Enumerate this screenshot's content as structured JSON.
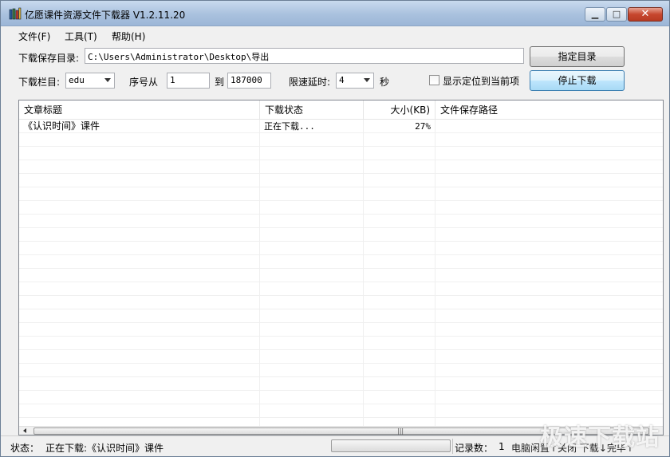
{
  "window": {
    "title": "亿愿课件资源文件下载器 V1.2.11.20",
    "controls": {
      "minimize": "▁",
      "maximize": "□",
      "close": "✕"
    }
  },
  "menu": {
    "items": [
      "文件(F)",
      "工具(T)",
      "帮助(H)"
    ]
  },
  "form": {
    "save_dir_label": "下载保存目录:",
    "save_dir_value": "C:\\Users\\Administrator\\Desktop\\导出",
    "choose_dir_button": "指定目录",
    "column_label": "下载栏目:",
    "column_value": "edu",
    "seq_from_label": "序号从",
    "seq_from_value": "1",
    "seq_to_label": "到",
    "seq_to_value": "187000",
    "delay_label": "限速延时:",
    "delay_value": "4",
    "delay_unit": "秒",
    "show_current_label": "显示定位到当前项",
    "show_current_checked": false,
    "stop_button": "停止下载"
  },
  "list": {
    "columns": [
      "文章标题",
      "下载状态",
      "大小(KB)",
      "文件保存路径"
    ],
    "rows": [
      {
        "title": "《认识时间》课件",
        "status": "正在下载...",
        "size": "27%",
        "path": ""
      }
    ]
  },
  "statusbar": {
    "state_label": "状态：",
    "state_text": "正在下载:《认识时间》课件",
    "records_label": "记录数：",
    "records_value": "1",
    "hint_text": "电脑闲置↑关闭 下载↓完毕↑"
  },
  "watermark": "极速下载站"
}
